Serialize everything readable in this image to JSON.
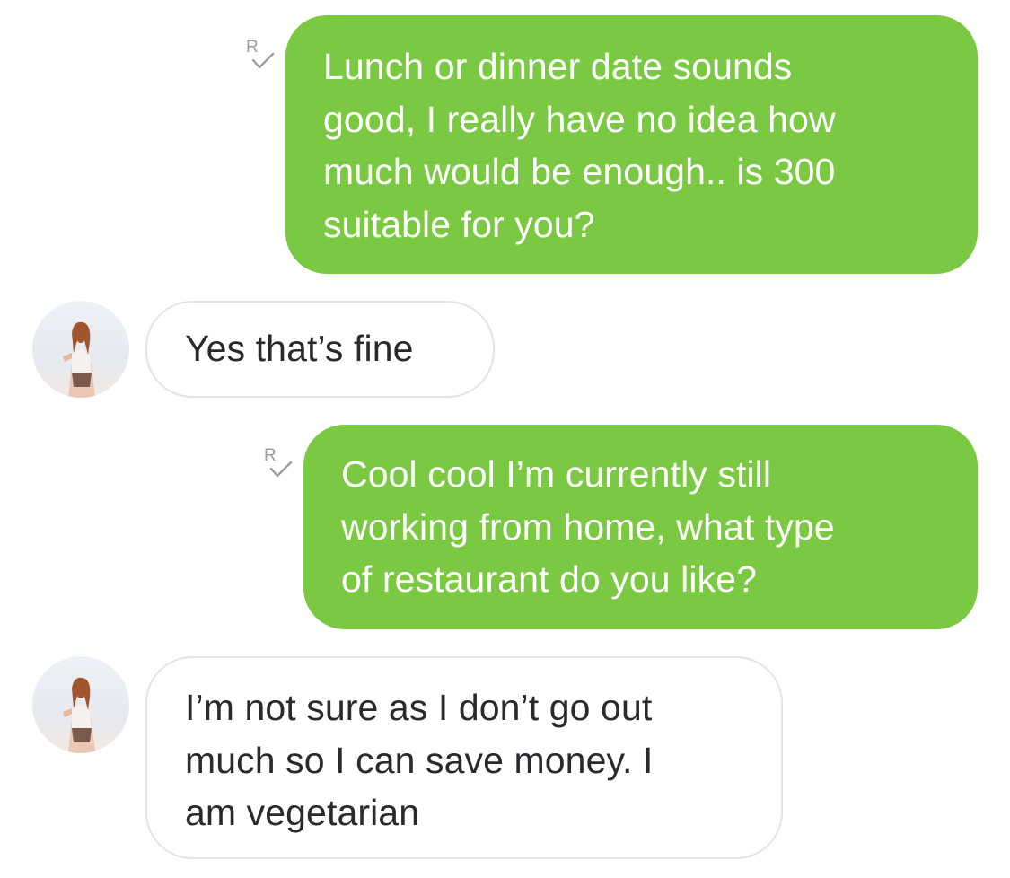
{
  "conversation": {
    "messages": [
      {
        "direction": "outgoing",
        "read_receipt": "R",
        "lines": [
          "Lunch or dinner date sounds",
          "good, I really have no idea how",
          "much would be enough.. is 300",
          "suitable for you?"
        ]
      },
      {
        "direction": "incoming",
        "lines": [
          "Yes that’s fine"
        ]
      },
      {
        "direction": "outgoing",
        "read_receipt": "R",
        "lines": [
          "Cool cool I’m currently still",
          "working from home, what type",
          "of restaurant do you like?"
        ]
      },
      {
        "direction": "incoming",
        "lines": [
          "I’m not sure as I don’t go out",
          "much so I can save money. I",
          "am vegetarian"
        ]
      }
    ]
  },
  "theme": {
    "outgoing_bubble_color": "#7bc943",
    "outgoing_text_color": "#ffffff",
    "incoming_bubble_color": "#ffffff",
    "incoming_border_color": "#e3e4e7",
    "incoming_text_color": "#2a2a2e",
    "receipt_color": "#9a9da6"
  },
  "icons": {
    "read_receipt": "read-receipt-icon",
    "contact_avatar": "contact-avatar"
  }
}
